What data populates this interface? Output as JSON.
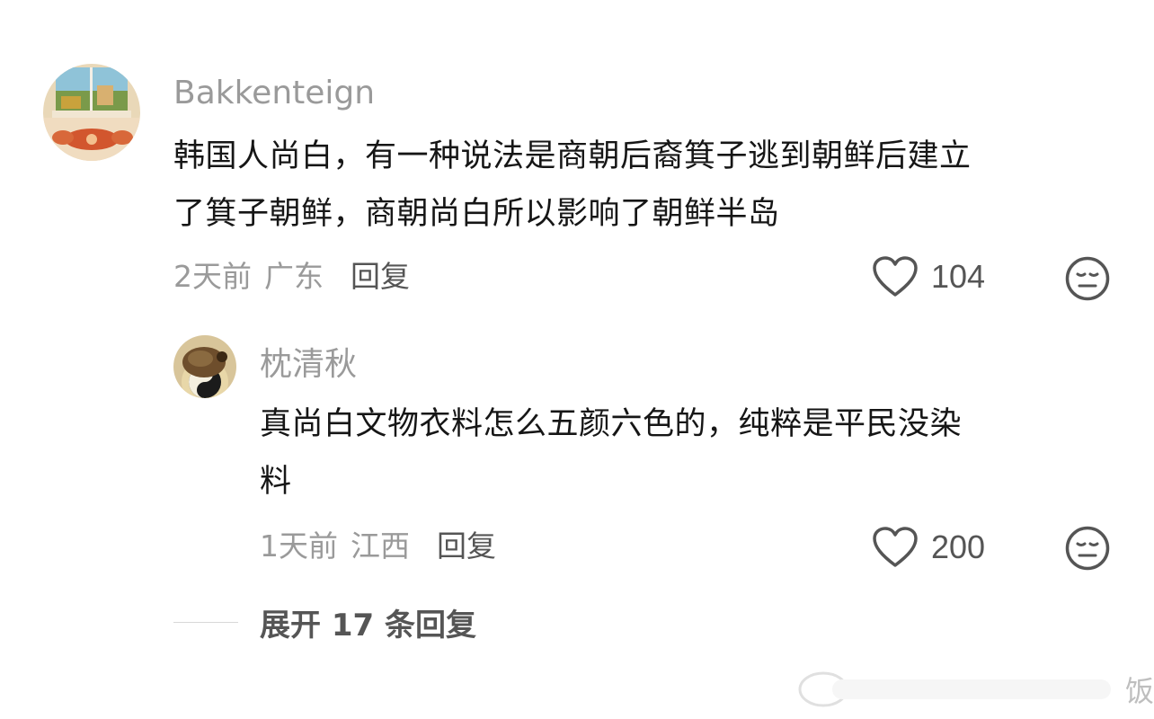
{
  "comments": [
    {
      "username": "Bakkenteign",
      "text_lines": [
        "韩国人尚白，有一种说法是商朝后裔箕子逃到朝鲜后建立",
        "了箕子朝鲜，商朝尚白所以影响了朝鲜半岛"
      ],
      "time": "2天前",
      "location": "广东",
      "reply_label": "回复",
      "like_count": "104"
    }
  ],
  "replies": [
    {
      "username": "枕清秋",
      "text_lines": [
        "真尚白文物衣料怎么五颜六色的，纯粹是平民没染",
        "料"
      ],
      "time": "1天前",
      "location": "江西",
      "reply_label": "回复",
      "like_count": "200"
    }
  ],
  "expand_replies": "展开 17 条回复",
  "watermark": "饭",
  "icons": {
    "like": "heart-outline-icon",
    "dislike": "neutral-face-icon"
  },
  "colors": {
    "username": "#9a9a9a",
    "text": "#161616",
    "meta": "#9a9a9a",
    "action": "#555555"
  }
}
